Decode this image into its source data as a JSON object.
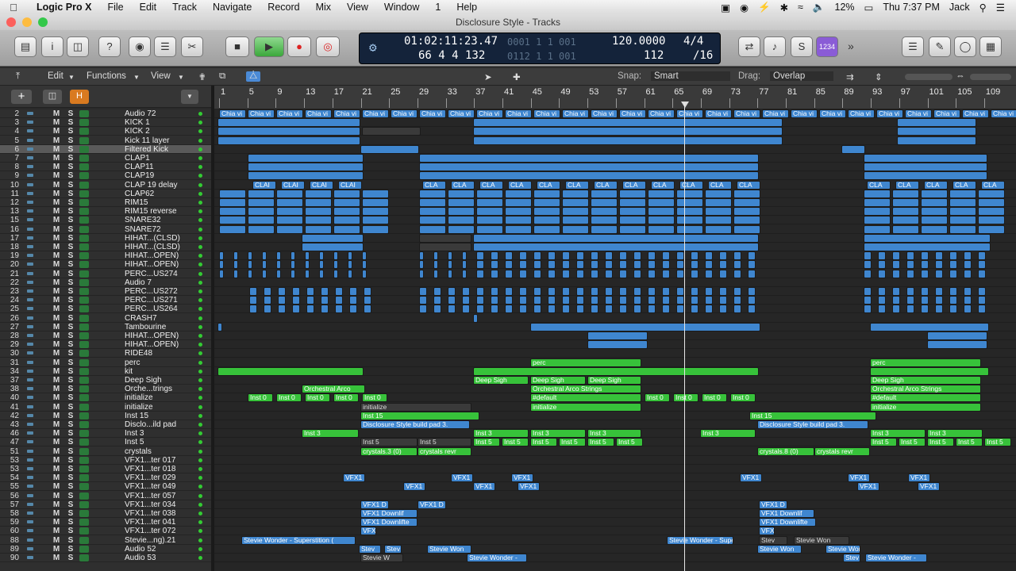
{
  "menubar": {
    "app": "Logic Pro X",
    "items": [
      "File",
      "Edit",
      "Track",
      "Navigate",
      "Record",
      "Mix",
      "View",
      "Window",
      "1",
      "Help"
    ],
    "battery": "12%",
    "time": "Thu 7:37 PM",
    "user": "Jack"
  },
  "window": {
    "title": "Disclosure Style - Tracks"
  },
  "lcd": {
    "time": "01:02:11:23.47",
    "bars_time": "0001 1 1 001",
    "bars": "66 4 4 132",
    "bars_end": "0112 1 1 001",
    "tempo": "120.0000",
    "tempo2": "112",
    "sig_top": "4/4",
    "sig_bot": "/16",
    "key_badge": "1234"
  },
  "toolbar": {
    "edit": "Edit",
    "functions": "Functions",
    "view": "View",
    "snap_label": "Snap:",
    "snap_value": "Smart",
    "drag_label": "Drag:",
    "drag_value": "Overlap"
  },
  "ruler": [
    "1",
    "5",
    "9",
    "13",
    "17",
    "21",
    "25",
    "29",
    "33",
    "37",
    "41",
    "45",
    "49",
    "53",
    "57",
    "61",
    "65",
    "69",
    "73",
    "77",
    "81",
    "85",
    "89",
    "93",
    "97",
    "101",
    "105",
    "109"
  ],
  "tracks": [
    {
      "n": "2",
      "name": "Audio 72"
    },
    {
      "n": "3",
      "name": "KICK 1"
    },
    {
      "n": "4",
      "name": "KICK 2"
    },
    {
      "n": "5",
      "name": "Kick 11 layer"
    },
    {
      "n": "6",
      "name": "Filtered Kick"
    },
    {
      "n": "7",
      "name": "CLAP1"
    },
    {
      "n": "8",
      "name": "CLAP11"
    },
    {
      "n": "9",
      "name": "CLAP19"
    },
    {
      "n": "10",
      "name": "CLAP 19 delay"
    },
    {
      "n": "11",
      "name": "CLAP62"
    },
    {
      "n": "12",
      "name": "RIM15"
    },
    {
      "n": "13",
      "name": "RIM15 reverse"
    },
    {
      "n": "15",
      "name": "SNARE32"
    },
    {
      "n": "16",
      "name": "SNARE72"
    },
    {
      "n": "17",
      "name": "HIHAT...(CLSD)"
    },
    {
      "n": "18",
      "name": "HIHAT...(CLSD)"
    },
    {
      "n": "19",
      "name": "HIHAT...OPEN)"
    },
    {
      "n": "20",
      "name": "HIHAT...OPEN)"
    },
    {
      "n": "21",
      "name": "PERC...US274"
    },
    {
      "n": "22",
      "name": "Audio 7"
    },
    {
      "n": "23",
      "name": "PERC...US272"
    },
    {
      "n": "24",
      "name": "PERC...US271"
    },
    {
      "n": "25",
      "name": "PERC...US264"
    },
    {
      "n": "26",
      "name": "CRASH7"
    },
    {
      "n": "27",
      "name": "Tambourine"
    },
    {
      "n": "28",
      "name": "HIHAT...OPEN)"
    },
    {
      "n": "29",
      "name": "HIHAT...OPEN)"
    },
    {
      "n": "30",
      "name": "RIDE48"
    },
    {
      "n": "31",
      "name": "perc"
    },
    {
      "n": "34",
      "name": "kit"
    },
    {
      "n": "37",
      "name": "Deep Sigh"
    },
    {
      "n": "38",
      "name": "Orche...trings"
    },
    {
      "n": "40",
      "name": "initialize"
    },
    {
      "n": "41",
      "name": "initialize"
    },
    {
      "n": "42",
      "name": "Inst 15"
    },
    {
      "n": "43",
      "name": "Disclo...ild pad"
    },
    {
      "n": "46",
      "name": "Inst 3"
    },
    {
      "n": "47",
      "name": "Inst 5"
    },
    {
      "n": "51",
      "name": "crystals"
    },
    {
      "n": "53",
      "name": "VFX1...ter 017"
    },
    {
      "n": "53",
      "name": "VFX1...ter 018"
    },
    {
      "n": "54",
      "name": "VFX1...ter 029"
    },
    {
      "n": "55",
      "name": "VFX1...ter 049"
    },
    {
      "n": "56",
      "name": "VFX1...ter 057"
    },
    {
      "n": "57",
      "name": "VFX1...ter 034"
    },
    {
      "n": "58",
      "name": "VFX1...ter 038"
    },
    {
      "n": "59",
      "name": "VFX1...ter 041"
    },
    {
      "n": "60",
      "name": "VFX1...ter 072"
    },
    {
      "n": "88",
      "name": "Stevie...ng).21"
    },
    {
      "n": "89",
      "name": "Audio 52"
    },
    {
      "n": "90",
      "name": "Audio 53"
    }
  ],
  "regions": {
    "chia": "Chia vi",
    "clap": "CLAI",
    "cla": "CLA",
    "perc": "perc",
    "deep": "Deep Sigh",
    "orch": "Orchestral Arco",
    "orch2": "Orchestral Arco Strings",
    "inst0": "Inst 0",
    "init": "initialize",
    "def": "#default",
    "inst15": "Inst 15",
    "pad": "Disclosure Style build pad 3.",
    "inst3": "Inst 3",
    "inst5": "Inst 5",
    "cry": "crystals.3 (0)",
    "cry2": "crystals revr",
    "cry3": "crystals.8 (0)",
    "vfx": "VFX1",
    "vfxd": "VFX1 D",
    "vfxdl": "VFX1 Downlif",
    "vfxdl2": "VFX1 Downlifte",
    "vfxs": "VFX",
    "stevie": "Stevie Wonder - Superstition (",
    "stevie2": "Stevie Wonder - Supers",
    "stevie3": "Stevie Won",
    "stevie4": "Stevie Wonder -",
    "stevie5": "Stevie W",
    "stev": "Stev",
    "stevw": "Stevie Won"
  }
}
